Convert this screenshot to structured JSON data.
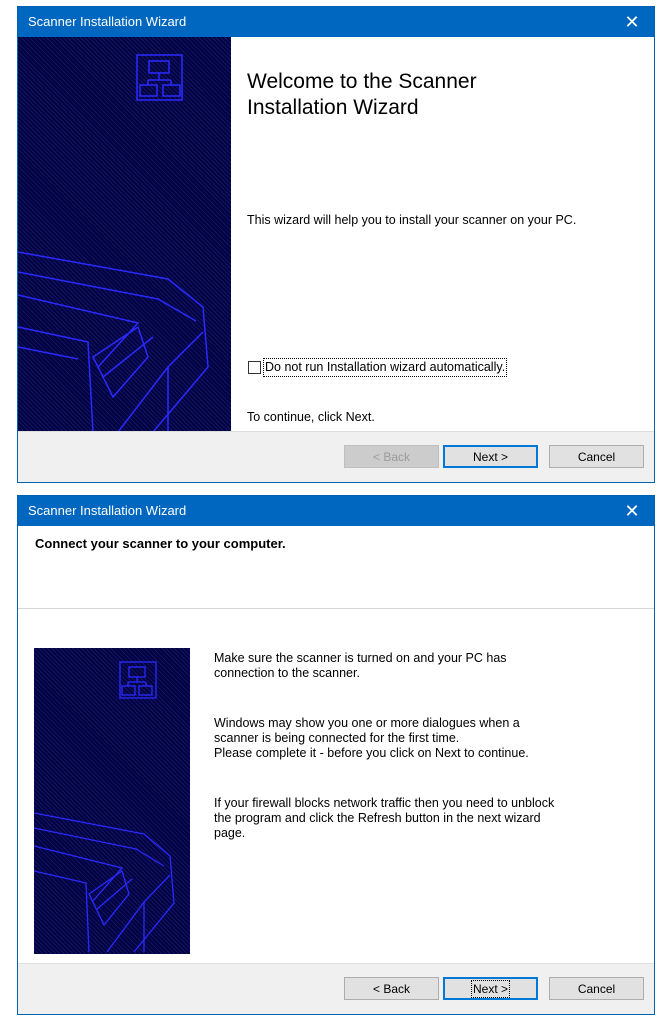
{
  "dialog1": {
    "title": "Scanner Installation Wizard",
    "close": "✕",
    "heading": "Welcome to the Scanner Installation Wizard",
    "intro": "This wizard will help you to install your scanner on your PC.",
    "checkbox_label": "Do not run Installation wizard automatically.",
    "checkbox_checked": false,
    "continue": "To continue, click Next.",
    "back_button": "< Back",
    "next_button": "Next >",
    "cancel_button": "Cancel"
  },
  "dialog2": {
    "title": "Scanner Installation Wizard",
    "close": "✕",
    "header": "Connect your scanner to your computer.",
    "para1": "Make sure the scanner is turned on and your PC has connection to the scanner.",
    "para2_line1": "Windows may show you one or more dialogues when a scanner is being connected for the first time.",
    "para2_line2": "Please complete it - before you click on Next to continue.",
    "para3": "If your firewall blocks network traffic then you need to unblock the program and click the Refresh button in the next wizard page.",
    "back_button": "< Back",
    "next_button": "Next >",
    "cancel_button": "Cancel"
  },
  "colors": {
    "titlebar": "#0067c0",
    "art_background": "#000044",
    "art_lines": "#2222ff"
  }
}
